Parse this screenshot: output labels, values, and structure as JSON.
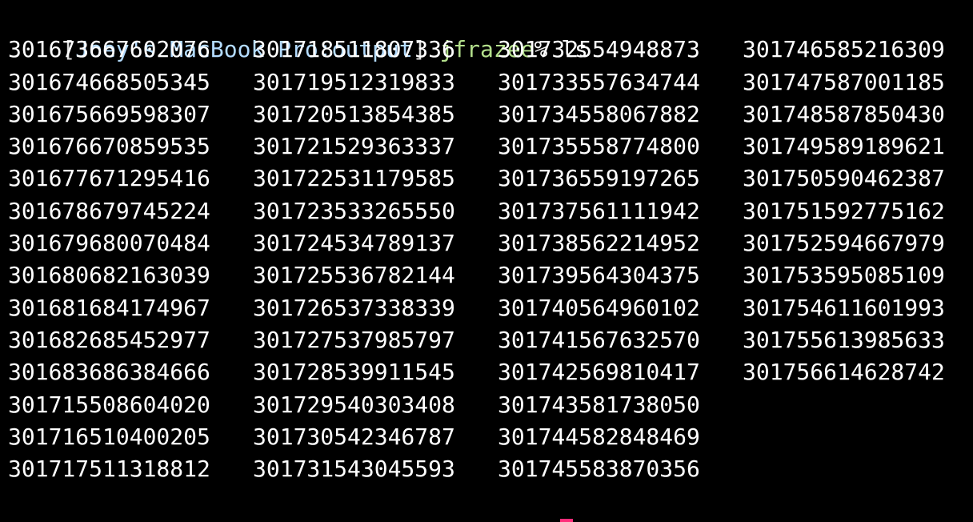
{
  "colors": {
    "background": "#000000",
    "text": "#ffffff",
    "host": "#b4dcff",
    "user": "#b4e08c",
    "cursor": "#ff2d7a"
  },
  "prompt": {
    "open_bracket": "[",
    "host_path": "Joey's MacBook Pro:output",
    "close_bracket": "]",
    "user": "jfrazee",
    "symbol": "%"
  },
  "command": "ls",
  "files": [
    [
      "301673667602076",
      "301718511807336",
      "301732554948873",
      "301746585216309"
    ],
    [
      "301674668505345",
      "301719512319833",
      "301733557634744",
      "301747587001185"
    ],
    [
      "301675669598307",
      "301720513854385",
      "301734558067882",
      "301748587850430"
    ],
    [
      "301676670859535",
      "301721529363337",
      "301735558774800",
      "301749589189621"
    ],
    [
      "301677671295416",
      "301722531179585",
      "301736559197265",
      "301750590462387"
    ],
    [
      "301678679745224",
      "301723533265550",
      "301737561111942",
      "301751592775162"
    ],
    [
      "301679680070484",
      "301724534789137",
      "301738562214952",
      "301752594667979"
    ],
    [
      "301680682163039",
      "301725536782144",
      "301739564304375",
      "301753595085109"
    ],
    [
      "301681684174967",
      "301726537338339",
      "301740564960102",
      "301754611601993"
    ],
    [
      "301682685452977",
      "301727537985797",
      "301741567632570",
      "301755613985633"
    ],
    [
      "301683686384666",
      "301728539911545",
      "301742569810417",
      "301756614628742"
    ],
    [
      "301715508604020",
      "301729540303408",
      "301743581738050",
      ""
    ],
    [
      "301716510400205",
      "301730542346787",
      "301744582848469",
      ""
    ],
    [
      "301717511318812",
      "301731543045593",
      "301745583870356",
      ""
    ]
  ]
}
